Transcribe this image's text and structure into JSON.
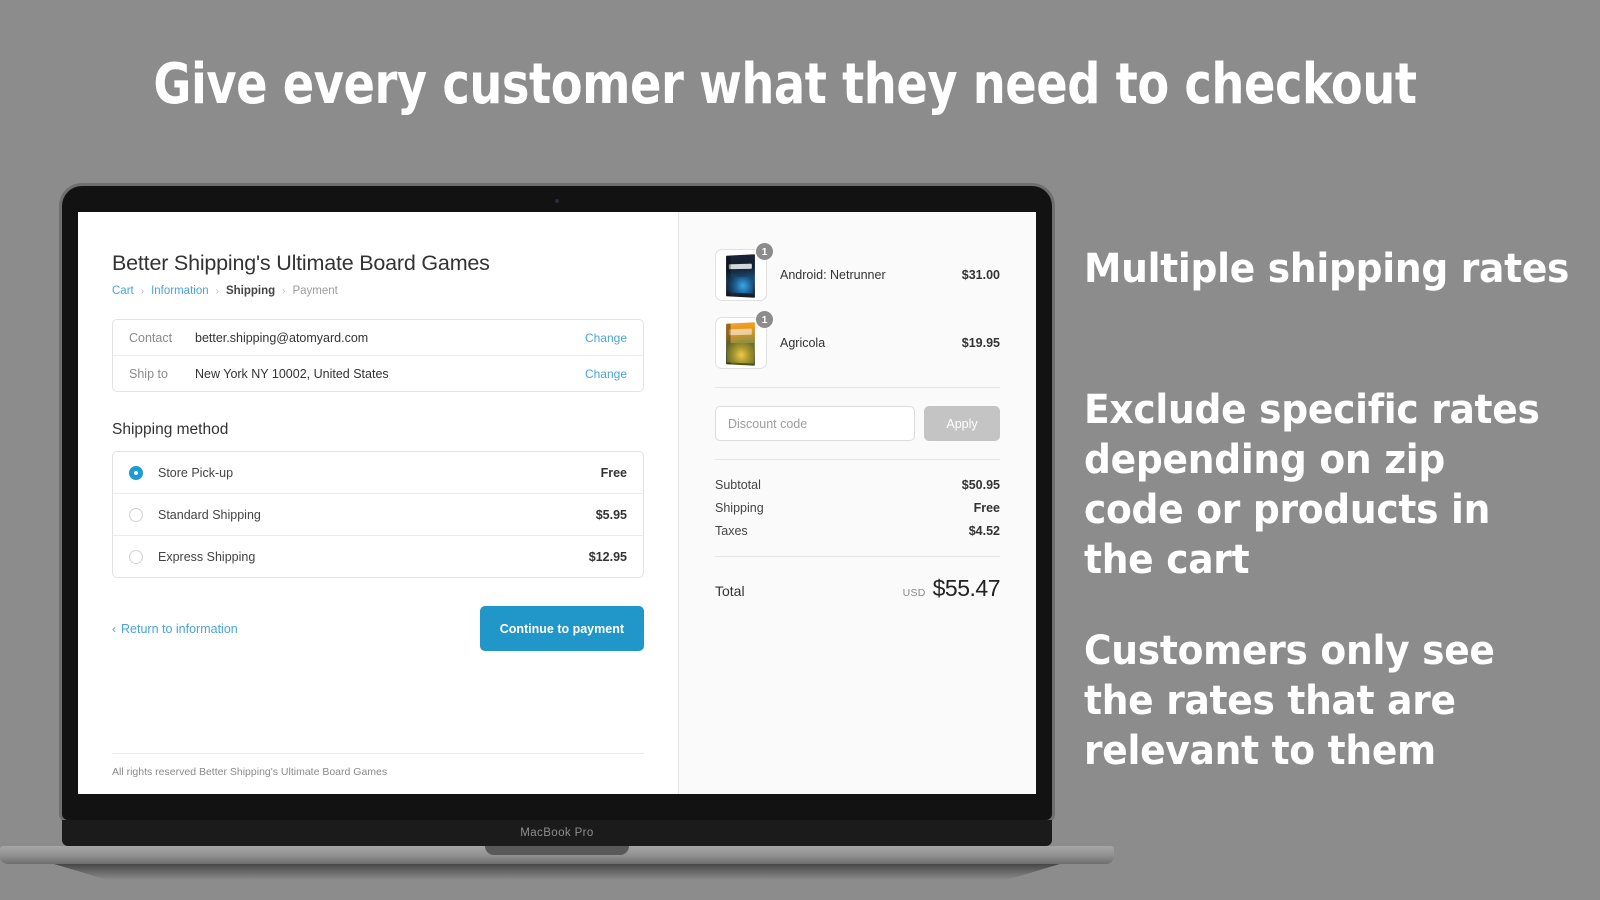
{
  "headline": "Give every customer what they need to checkout",
  "marketing": {
    "point1": "Multiple shipping rates",
    "point2": "Exclude specific rates depending on zip code or products in the cart",
    "point3": "Customers only see the rates that are relevant to them"
  },
  "device": {
    "model_label": "MacBook Pro"
  },
  "colors": {
    "background": "#8c8c8c",
    "accent_blue": "#2196c9",
    "link_blue": "#4aa3df",
    "radio_selected": "#1e9bd7",
    "apply_disabled": "#c4c4c4",
    "sidebar_bg": "#fafafa"
  },
  "checkout": {
    "shop_title": "Better Shipping's Ultimate Board Games",
    "breadcrumb": [
      {
        "label": "Cart",
        "state": "link"
      },
      {
        "label": "Information",
        "state": "link"
      },
      {
        "label": "Shipping",
        "state": "active"
      },
      {
        "label": "Payment",
        "state": "muted"
      }
    ],
    "breadcrumb_separator": "›",
    "info": {
      "contact": {
        "label": "Contact",
        "value": "better.shipping@atomyard.com",
        "change": "Change"
      },
      "ship_to": {
        "label": "Ship to",
        "value": "New York NY 10002, United States",
        "change": "Change"
      }
    },
    "shipping_section_title": "Shipping method",
    "shipping_rates": [
      {
        "name": "Store Pick-up",
        "price": "Free",
        "selected": true
      },
      {
        "name": "Standard Shipping",
        "price": "$5.95",
        "selected": false
      },
      {
        "name": "Express Shipping",
        "price": "$12.95",
        "selected": false
      }
    ],
    "back_link": "Return to information",
    "back_chevron": "‹",
    "continue_button": "Continue to payment",
    "footer_note": "All rights reserved Better Shipping's Ultimate Board Games",
    "summary": {
      "items": [
        {
          "name": "Android: Netrunner",
          "price": "$31.00",
          "qty": "1",
          "art": "netrunner"
        },
        {
          "name": "Agricola",
          "price": "$19.95",
          "qty": "1",
          "art": "agricola"
        }
      ],
      "discount_placeholder": "Discount code",
      "apply_label": "Apply",
      "lines": [
        {
          "label": "Subtotal",
          "value": "$50.95"
        },
        {
          "label": "Shipping",
          "value": "Free"
        },
        {
          "label": "Taxes",
          "value": "$4.52"
        }
      ],
      "total_label": "Total",
      "total_currency": "USD",
      "total_value": "$55.47"
    }
  }
}
